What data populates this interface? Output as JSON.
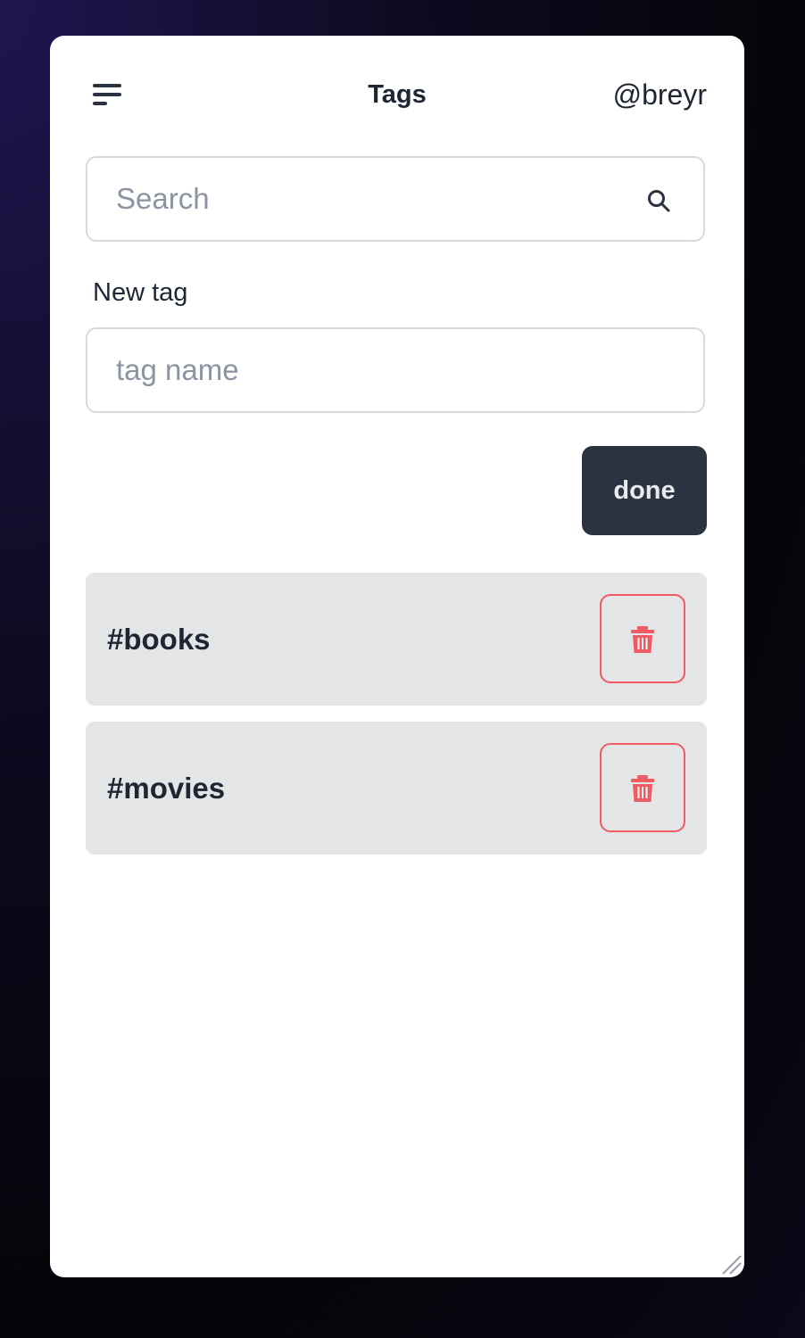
{
  "header": {
    "title": "Tags",
    "username": "@breyr"
  },
  "search": {
    "placeholder": "Search",
    "value": ""
  },
  "new_tag": {
    "label": "New tag",
    "placeholder": "tag name",
    "value": ""
  },
  "done_label": "done",
  "tags": [
    {
      "label": "#books"
    },
    {
      "label": "#movies"
    }
  ],
  "icons": {
    "menu": "menu-icon",
    "search": "search-icon",
    "delete": "trash-icon",
    "resize": "resize-grip-icon"
  },
  "colors": {
    "primary_dark": "#2b3240",
    "danger": "#ef5b63",
    "row_bg": "#e4e5e6",
    "text": "#1f2633",
    "placeholder": "#8c94a3"
  }
}
